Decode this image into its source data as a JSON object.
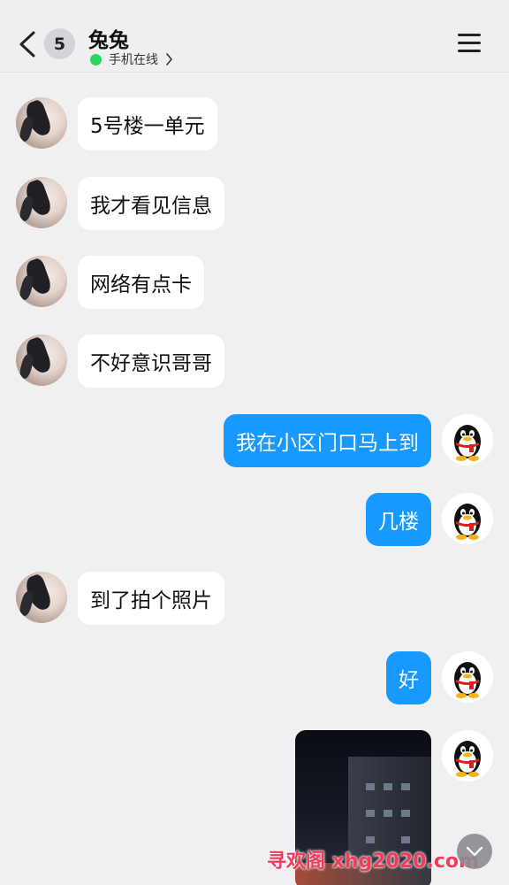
{
  "header": {
    "unread_count": "5",
    "contact_name": "兔兔",
    "status_text": "手机在线"
  },
  "messages": [
    {
      "side": "in",
      "text": "5号楼一单元"
    },
    {
      "side": "in",
      "text": "我才看见信息"
    },
    {
      "side": "in",
      "text": "网络有点卡"
    },
    {
      "side": "in",
      "text": "不好意识哥哥"
    },
    {
      "side": "out",
      "text": "我在小区门口马上到"
    },
    {
      "side": "out",
      "text": "几楼"
    },
    {
      "side": "in",
      "text": "到了拍个照片"
    },
    {
      "side": "out",
      "text": "好"
    }
  ],
  "watermark": "寻欢阁 xhg2020.com",
  "colors": {
    "outgoing_bubble": "#1799ff",
    "incoming_bubble": "#ffffff",
    "online_dot": "#2bd760",
    "background": "#f0f0f3"
  },
  "icons": {
    "back": "chevron-left-icon",
    "menu": "hamburger-menu-icon",
    "scroll_down": "chevron-down-icon",
    "self_avatar": "qq-penguin-icon"
  }
}
